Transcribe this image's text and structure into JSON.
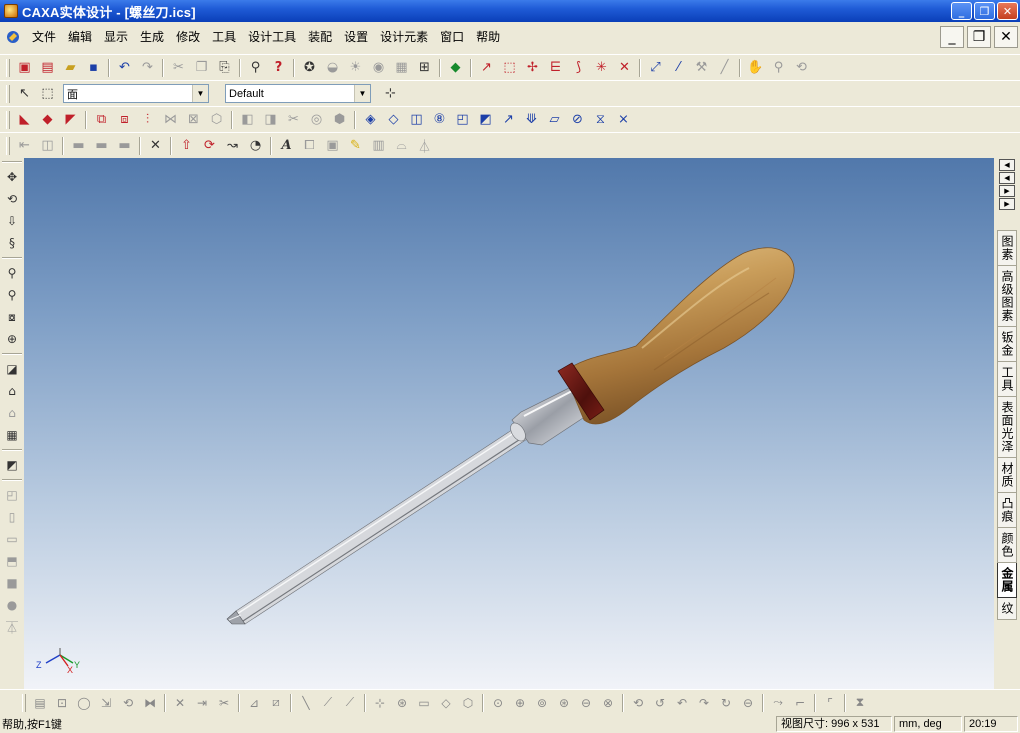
{
  "window": {
    "title": "CAXA实体设计 - [螺丝刀.ics]",
    "minimize": "_",
    "restore": "❐",
    "close": "✕"
  },
  "menu": {
    "items": [
      "文件",
      "编辑",
      "显示",
      "生成",
      "修改",
      "工具",
      "设计工具",
      "装配",
      "设置",
      "设计元素",
      "窗口",
      "帮助"
    ],
    "mdi_min": "_",
    "mdi_restore": "❐",
    "mdi_close": "✕"
  },
  "toolbar2": {
    "filter_combo": "面",
    "style_combo": "Default"
  },
  "viewport": {
    "axis_x": "X",
    "axis_y": "Y",
    "axis_z": "Z",
    "colors": {
      "bg_top": "#5178ab",
      "bg_bottom": "#f1f3f8",
      "handle": "#c49a5c",
      "ring": "#6b1a14",
      "steel": "#c9ccd2"
    }
  },
  "right_tabs": [
    "图素",
    "高级图素",
    "钣金",
    "工具",
    "表面光泽",
    "材质",
    "凸痕",
    "颜色",
    "金属",
    "纹"
  ],
  "right_tabs_active": "金属",
  "status": {
    "help": "帮助,按F1键",
    "view_size_label": "视图尺寸:",
    "view_size": "996 x 531",
    "units": "mm, deg",
    "time": "20:19"
  }
}
